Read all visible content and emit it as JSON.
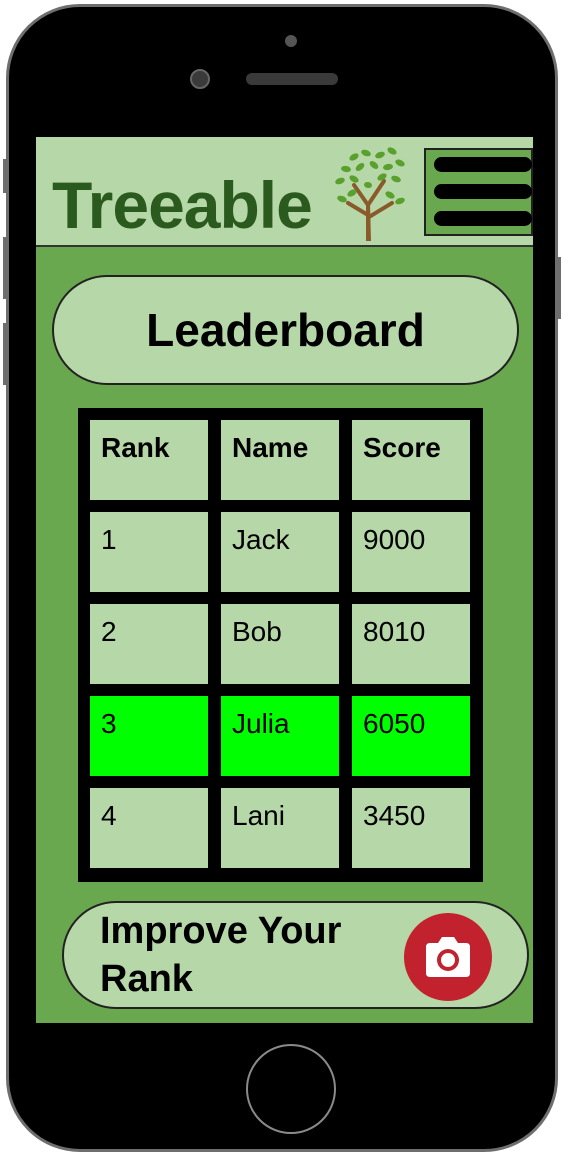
{
  "header": {
    "brand": "Treeable",
    "menu_icon": "hamburger-menu-icon",
    "logo_icon": "tree-icon"
  },
  "leaderboard": {
    "title": "Leaderboard",
    "columns": [
      "Rank",
      "Name",
      "Score"
    ],
    "rows": [
      [
        "1",
        "Jack",
        "9000"
      ],
      [
        "2",
        "Bob",
        "8010"
      ],
      [
        "3",
        "Julia",
        "6050"
      ],
      [
        "4",
        "Lani",
        "3450"
      ]
    ],
    "highlighted_rank": "3"
  },
  "cta": {
    "line1": "Improve Your",
    "line2": "Rank",
    "icon": "camera-icon"
  },
  "colors": {
    "screen_bg": "#6aa84f",
    "panel_bg": "#b6d7a8",
    "brand_text": "#2b5a1e",
    "highlight": "#00ff00",
    "camera_button": "#c2222e"
  }
}
